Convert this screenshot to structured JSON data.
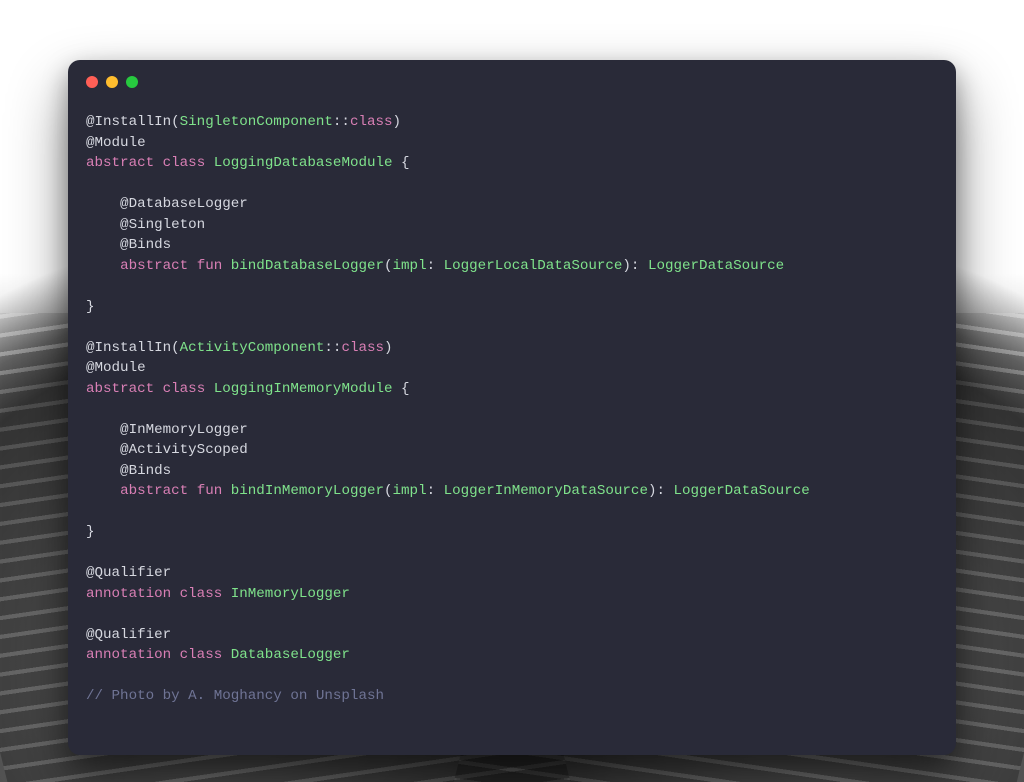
{
  "window": {
    "dots": [
      "red",
      "yellow",
      "green"
    ]
  },
  "code": {
    "lines": [
      [
        {
          "t": "@InstallIn(",
          "c": "punc"
        },
        {
          "t": "SingletonComponent",
          "c": "fn"
        },
        {
          "t": "::",
          "c": "punc"
        },
        {
          "t": "class",
          "c": "kw"
        },
        {
          "t": ")",
          "c": "punc"
        }
      ],
      [
        {
          "t": "@Module",
          "c": "punc"
        }
      ],
      [
        {
          "t": "abstract",
          "c": "kw"
        },
        {
          "t": " ",
          "c": "punc"
        },
        {
          "t": "class",
          "c": "kw"
        },
        {
          "t": " ",
          "c": "punc"
        },
        {
          "t": "LoggingDatabaseModule",
          "c": "fn"
        },
        {
          "t": " {",
          "c": "punc"
        }
      ],
      [],
      [
        {
          "t": "    @DatabaseLogger",
          "c": "punc"
        }
      ],
      [
        {
          "t": "    @Singleton",
          "c": "punc"
        }
      ],
      [
        {
          "t": "    @Binds",
          "c": "punc"
        }
      ],
      [
        {
          "t": "    ",
          "c": "punc"
        },
        {
          "t": "abstract",
          "c": "kw"
        },
        {
          "t": " ",
          "c": "punc"
        },
        {
          "t": "fun",
          "c": "kw"
        },
        {
          "t": " ",
          "c": "punc"
        },
        {
          "t": "bindDatabaseLogger",
          "c": "fn"
        },
        {
          "t": "(",
          "c": "punc"
        },
        {
          "t": "impl",
          "c": "fn"
        },
        {
          "t": ": ",
          "c": "punc"
        },
        {
          "t": "LoggerLocalDataSource",
          "c": "fn"
        },
        {
          "t": "): ",
          "c": "punc"
        },
        {
          "t": "LoggerDataSource",
          "c": "fn"
        }
      ],
      [],
      [
        {
          "t": "}",
          "c": "punc"
        }
      ],
      [],
      [
        {
          "t": "@InstallIn(",
          "c": "punc"
        },
        {
          "t": "ActivityComponent",
          "c": "fn"
        },
        {
          "t": "::",
          "c": "punc"
        },
        {
          "t": "class",
          "c": "kw"
        },
        {
          "t": ")",
          "c": "punc"
        }
      ],
      [
        {
          "t": "@Module",
          "c": "punc"
        }
      ],
      [
        {
          "t": "abstract",
          "c": "kw"
        },
        {
          "t": " ",
          "c": "punc"
        },
        {
          "t": "class",
          "c": "kw"
        },
        {
          "t": " ",
          "c": "punc"
        },
        {
          "t": "LoggingInMemoryModule",
          "c": "fn"
        },
        {
          "t": " {",
          "c": "punc"
        }
      ],
      [],
      [
        {
          "t": "    @InMemoryLogger",
          "c": "punc"
        }
      ],
      [
        {
          "t": "    @ActivityScoped",
          "c": "punc"
        }
      ],
      [
        {
          "t": "    @Binds",
          "c": "punc"
        }
      ],
      [
        {
          "t": "    ",
          "c": "punc"
        },
        {
          "t": "abstract",
          "c": "kw"
        },
        {
          "t": " ",
          "c": "punc"
        },
        {
          "t": "fun",
          "c": "kw"
        },
        {
          "t": " ",
          "c": "punc"
        },
        {
          "t": "bindInMemoryLogger",
          "c": "fn"
        },
        {
          "t": "(",
          "c": "punc"
        },
        {
          "t": "impl",
          "c": "fn"
        },
        {
          "t": ": ",
          "c": "punc"
        },
        {
          "t": "LoggerInMemoryDataSource",
          "c": "fn"
        },
        {
          "t": "): ",
          "c": "punc"
        },
        {
          "t": "LoggerDataSource",
          "c": "fn"
        }
      ],
      [],
      [
        {
          "t": "}",
          "c": "punc"
        }
      ],
      [],
      [
        {
          "t": "@Qualifier",
          "c": "punc"
        }
      ],
      [
        {
          "t": "annotation",
          "c": "kw"
        },
        {
          "t": " ",
          "c": "punc"
        },
        {
          "t": "class",
          "c": "kw"
        },
        {
          "t": " ",
          "c": "punc"
        },
        {
          "t": "InMemoryLogger",
          "c": "fn"
        }
      ],
      [],
      [
        {
          "t": "@Qualifier",
          "c": "punc"
        }
      ],
      [
        {
          "t": "annotation",
          "c": "kw"
        },
        {
          "t": " ",
          "c": "punc"
        },
        {
          "t": "class",
          "c": "kw"
        },
        {
          "t": " ",
          "c": "punc"
        },
        {
          "t": "DatabaseLogger",
          "c": "fn"
        }
      ],
      [],
      [
        {
          "t": "// Photo by A. Moghancy on Unsplash",
          "c": "cmt"
        }
      ]
    ]
  }
}
